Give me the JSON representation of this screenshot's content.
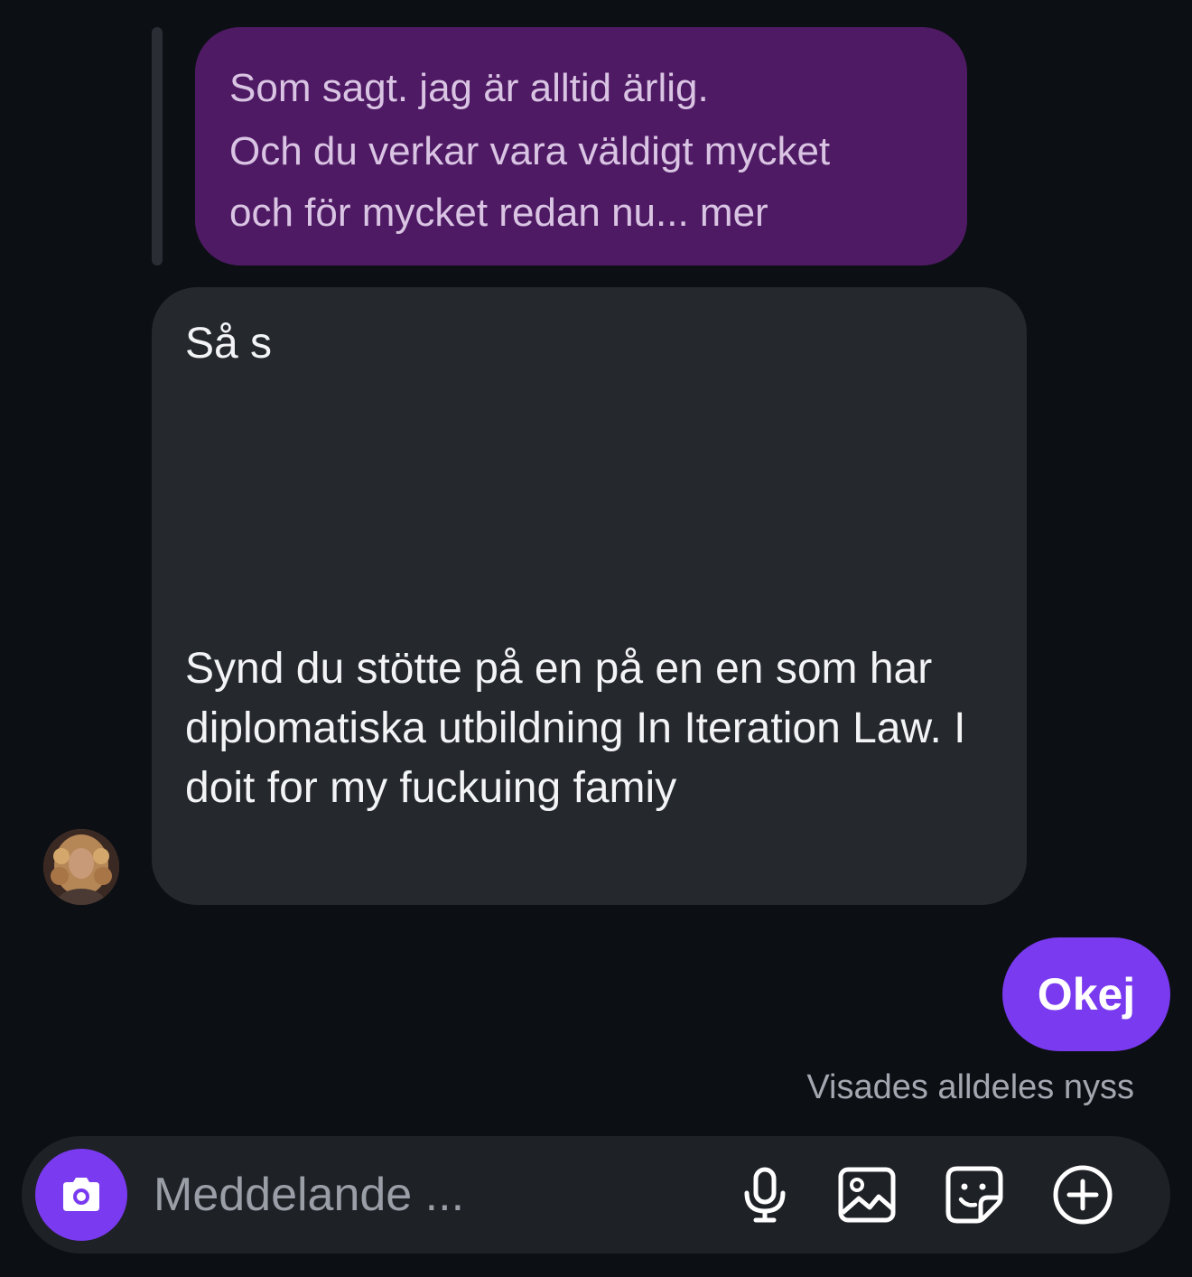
{
  "conversation": {
    "quoted_message": {
      "lines": [
        "Som sagt. jag är alltid ärlig.",
        "Och du verkar vara väldigt mycket",
        "och för mycket redan nu... mer"
      ]
    },
    "incoming_message": {
      "head": "Så s",
      "body": "Synd du stötte på en på en en som har diplomatiska utbildning In Iteration Law. I doit for my fuckuing famiy"
    },
    "outgoing_message": {
      "text": "Okej"
    },
    "seen_status": "Visades alldeles nyss"
  },
  "composer": {
    "placeholder": "Meddelande ...",
    "icons": {
      "camera": "camera-icon",
      "mic": "microphone-icon",
      "gallery": "image-icon",
      "sticker": "sticker-icon",
      "more": "plus-circle-icon"
    }
  },
  "colors": {
    "background": "#0c0f14",
    "quoted_bubble": "#4f1a64",
    "incoming_bubble": "#25282d",
    "accent": "#7a3af0"
  }
}
